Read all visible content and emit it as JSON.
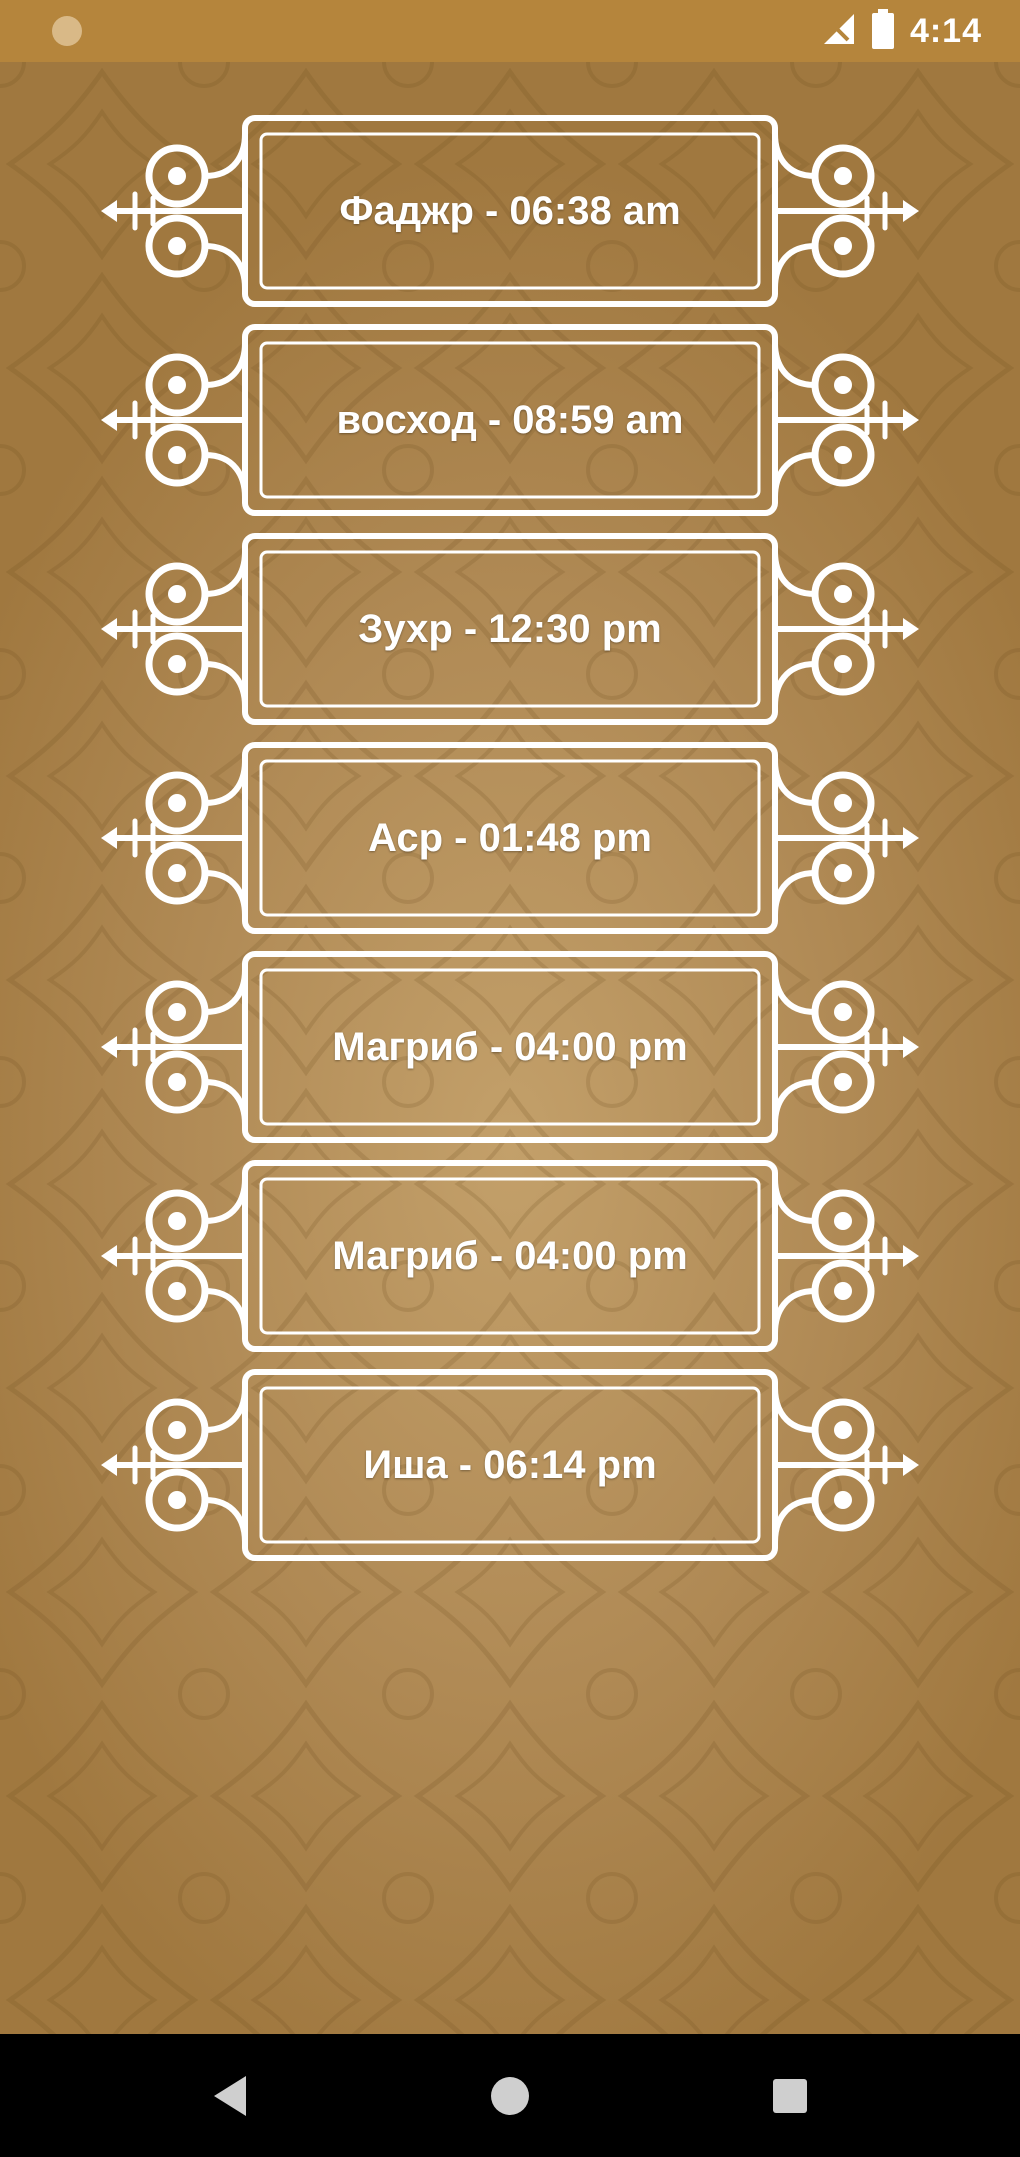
{
  "status_bar": {
    "time": "4:14",
    "left_icon": "notification-dot-icon",
    "signal_icon": "signal-off-icon",
    "battery_icon": "battery-icon"
  },
  "colors": {
    "status_bar": "#b5853c",
    "background": "#b08a55",
    "frame": "#ffffff",
    "nav_bar": "#000000"
  },
  "prayers": [
    {
      "label": "Фаджр - 06:38 am"
    },
    {
      "label": "восход - 08:59 am"
    },
    {
      "label": "Зухр - 12:30 pm"
    },
    {
      "label": "Аср - 01:48 pm"
    },
    {
      "label": "Магриб - 04:00 pm"
    },
    {
      "label": "Магриб - 04:00 pm"
    },
    {
      "label": "Иша - 06:14 pm"
    }
  ],
  "nav_bar": {
    "back_icon": "back-triangle-icon",
    "home_icon": "home-circle-icon",
    "recents_icon": "recents-square-icon"
  }
}
